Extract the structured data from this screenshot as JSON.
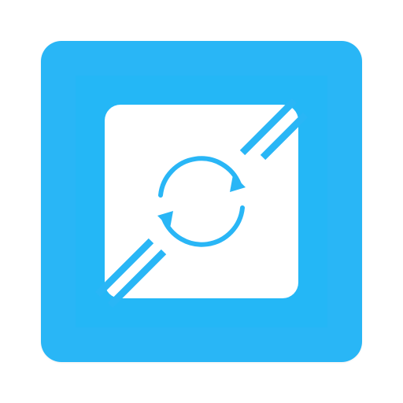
{
  "app_icon": {
    "name": "photo-sync-app-icon",
    "icon": "sync-arrows-in-frame-icon",
    "colors": {
      "background": "#29b6f6",
      "inner_background": "#20b8f5",
      "frame": "#ffffff",
      "glyph": "#29b6f6"
    }
  }
}
